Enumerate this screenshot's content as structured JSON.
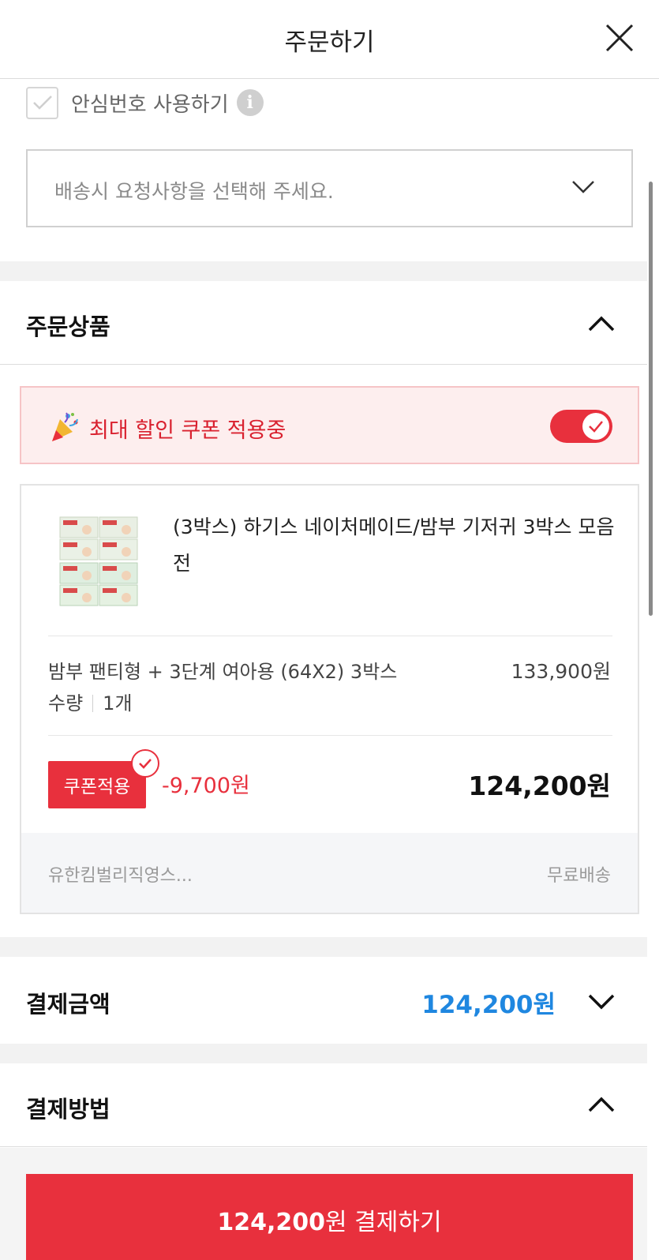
{
  "header": {
    "title": "주문하기"
  },
  "safe_number": {
    "label": "안심번호 사용하기",
    "checked": true,
    "info_icon": "i"
  },
  "delivery_request": {
    "placeholder": "배송시 요청사항을 선택해 주세요."
  },
  "order_items": {
    "title": "주문상품",
    "coupon_banner": {
      "text": "최대 할인 쿠폰 적용중",
      "toggle_on": true
    },
    "product": {
      "name": "(3박스) 하기스 네이처메이드/밤부 기저귀 3박스 모음전",
      "option": "밤부 팬티형 + 3단계 여아용 (64X2) 3박스",
      "quantity_label": "수량",
      "quantity_value": "1개",
      "option_price": "133,900원",
      "coupon_badge": "쿠폰적용",
      "discount": "-9,700원",
      "final_price": "124,200원",
      "seller": "유한킴벌리직영스...",
      "shipping": "무료배송"
    }
  },
  "payment_amount": {
    "title": "결제금액",
    "value": "124,200원"
  },
  "payment_method": {
    "title": "결제방법"
  },
  "pay_button": {
    "amount": "124,200",
    "suffix": "원 결제하기"
  },
  "colors": {
    "accent_red": "#e8303d",
    "link_blue": "#1f87e0",
    "banner_bg": "#fdeeee"
  }
}
